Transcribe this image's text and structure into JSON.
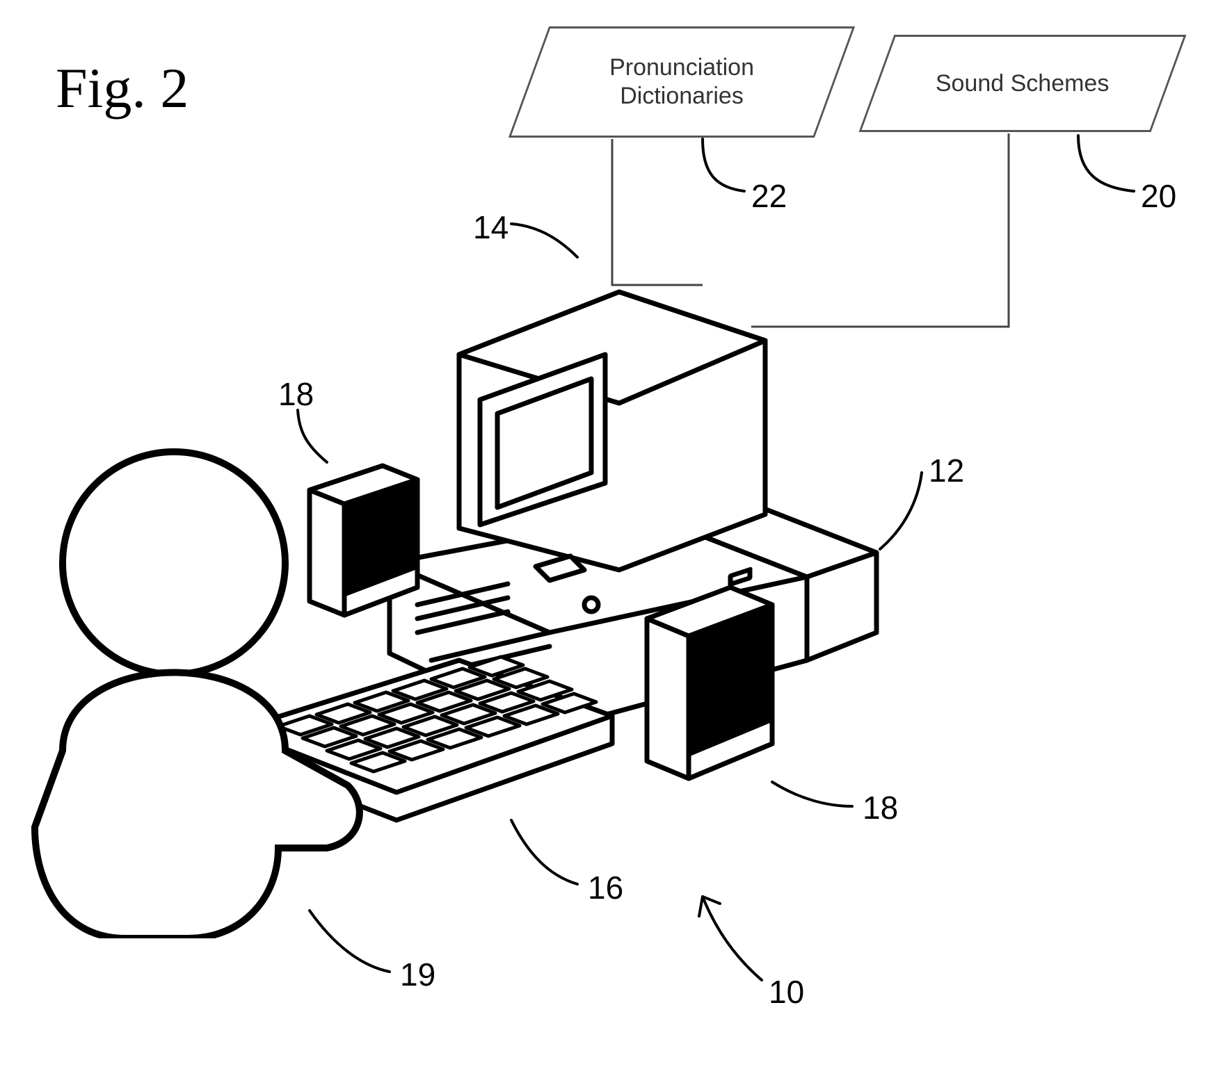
{
  "figure_title": "Fig. 2",
  "boxes": {
    "pronunciation": "Pronunciation\nDictionaries",
    "sound_schemes": "Sound Schemes"
  },
  "labels": {
    "n10": "10",
    "n12": "12",
    "n14": "14",
    "n16": "16",
    "n18a": "18",
    "n18b": "18",
    "n19": "19",
    "n20": "20",
    "n22": "22"
  }
}
